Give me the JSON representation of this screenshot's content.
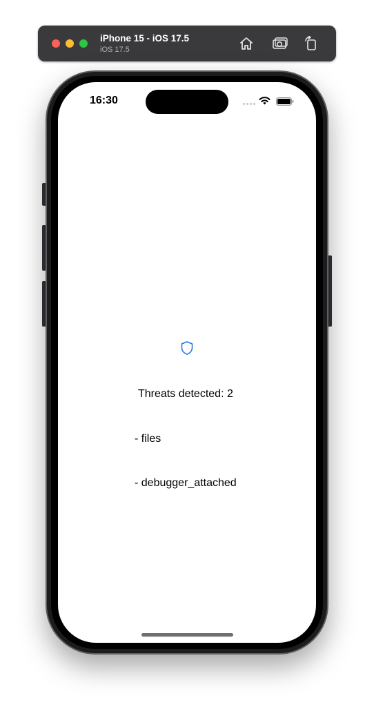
{
  "simulator": {
    "title": "iPhone 15 - iOS 17.5",
    "subtitle": "iOS 17.5",
    "buttons": [
      {
        "icon": "home-icon"
      },
      {
        "icon": "screenshot-icon"
      },
      {
        "icon": "rotate-icon"
      }
    ]
  },
  "status_bar": {
    "time": "16:30"
  },
  "app": {
    "icon": "shield-icon",
    "accent_color": "#1a73e8",
    "threat_title": "Threats detected: 2",
    "threats": [
      "- files",
      "- debugger_attached"
    ]
  }
}
